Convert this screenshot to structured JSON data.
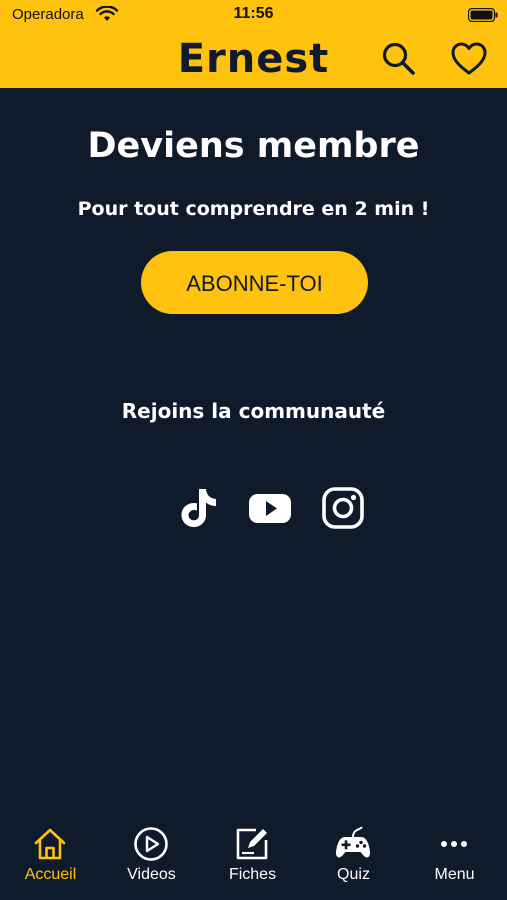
{
  "status_bar": {
    "carrier": "Operadora",
    "time": "11:56"
  },
  "header": {
    "title": "Ernest",
    "search_icon": "search-icon",
    "favorites_icon": "heart-icon"
  },
  "hero": {
    "headline": "Deviens membre",
    "subline": "Pour tout comprendre en 2 min !",
    "cta_label": "ABONNE-TOI"
  },
  "community": {
    "label": "Rejoins la communauté",
    "networks": [
      "tiktok-icon",
      "youtube-icon",
      "instagram-icon"
    ]
  },
  "tabs": [
    {
      "label": "Accueil",
      "icon": "home-icon",
      "active": true
    },
    {
      "label": "Videos",
      "icon": "play-circle-icon",
      "active": false
    },
    {
      "label": "Fiches",
      "icon": "edit-note-icon",
      "active": false
    },
    {
      "label": "Quiz",
      "icon": "gamepad-icon",
      "active": false
    },
    {
      "label": "Menu",
      "icon": "more-dots-icon",
      "active": false
    }
  ],
  "colors": {
    "brand_yellow": "#ffc20e",
    "background_navy": "#0f1a2b",
    "text_white": "#ffffff"
  }
}
